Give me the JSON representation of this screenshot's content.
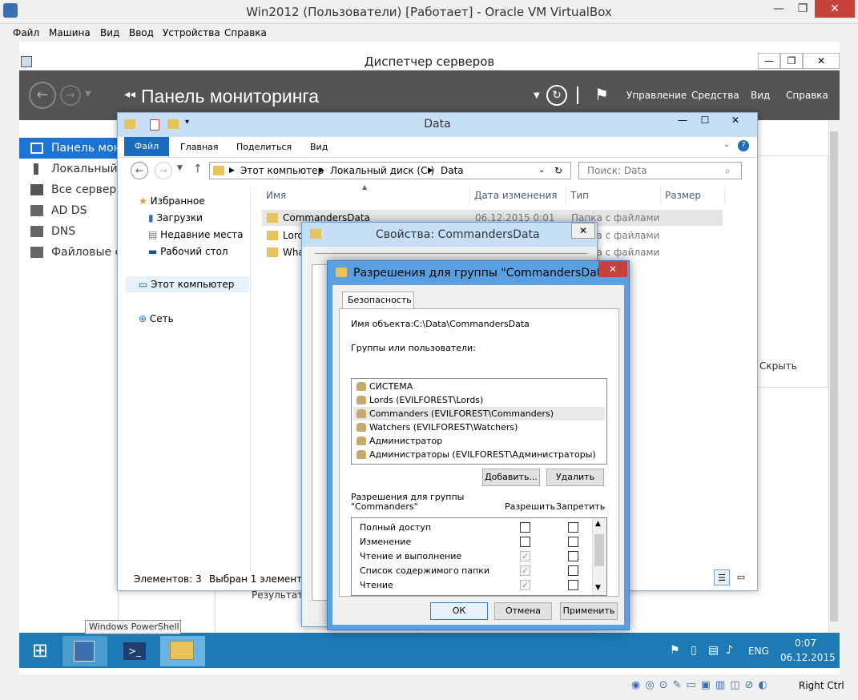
{
  "vbox": {
    "title": "Win2012 (Пользователи) [Работает] - Oracle VM VirtualBox",
    "menu": [
      "Файл",
      "Машина",
      "Вид",
      "Ввод",
      "Устройства",
      "Справка"
    ],
    "host_key": "Right Ctrl"
  },
  "server_manager": {
    "window_title": "Диспетчер серверов",
    "header_title": "Панель мониторинга",
    "header_menu": [
      "Управление",
      "Средства",
      "Вид",
      "Справка"
    ],
    "sidebar": [
      {
        "label": "Панель мони",
        "icon": "dashboard-icon",
        "active": true
      },
      {
        "label": "Локальный с",
        "icon": "server-icon",
        "active": false
      },
      {
        "label": "Все серверы",
        "icon": "servers-icon",
        "active": false
      },
      {
        "label": "AD DS",
        "icon": "ad-icon",
        "active": false
      },
      {
        "label": "DNS",
        "icon": "dns-icon",
        "active": false
      },
      {
        "label": "Файловые сл",
        "icon": "file-services-icon",
        "active": false
      }
    ],
    "hide_label": "Скрыть",
    "results_label": "Результат"
  },
  "taskbar": {
    "tooltip": "Windows PowerShell",
    "language": "ENG",
    "time": "0:07",
    "date": "06.12.2015"
  },
  "explorer": {
    "title": "Data",
    "ribbon_tabs": [
      "Файл",
      "Главная",
      "Поделиться",
      "Вид"
    ],
    "address": [
      "Этот компьютер",
      "Локальный диск (C:)",
      "Data"
    ],
    "search_placeholder": "Поиск: Data",
    "nav": {
      "favorites": "Избранное",
      "downloads": "Загрузки",
      "recent": "Недавние места",
      "desktop": "Рабочий стол",
      "this_pc": "Этот компьютер",
      "network": "Сеть"
    },
    "columns": [
      "Имя",
      "Дата изменения",
      "Тип",
      "Размер"
    ],
    "rows": [
      {
        "name": "CommandersData",
        "date": "06.12.2015 0:01",
        "type": "Папка с файлами"
      },
      {
        "name": "Lords",
        "date": "",
        "type": "Папка с файлами"
      },
      {
        "name": "Wha",
        "date": "",
        "type": "Папка с файлами"
      }
    ],
    "status_count": "Элементов: 3",
    "status_selected": "Выбран 1 элемент"
  },
  "properties": {
    "title": "Свойства: CommandersData"
  },
  "permissions": {
    "title": "Разрешения для группы \"CommandersData\"",
    "tab": "Безопасность",
    "object_label": "Имя объекта:",
    "object_value": "C:\\Data\\CommandersData",
    "groups_label": "Группы или пользователи:",
    "users": [
      "СИСТЕМА",
      "Lords (EVILFOREST\\Lords)",
      "Commanders (EVILFOREST\\Commanders)",
      "Watchers (EVILFOREST\\Watchers)",
      "Администратор",
      "Администраторы (EVILFOREST\\Администраторы)"
    ],
    "add_button": "Добавить...",
    "remove_button": "Удалить",
    "perm_for_label_1": "Разрешения для группы",
    "perm_for_label_2": "\"Commanders\"",
    "allow_label": "Разрешить",
    "deny_label": "Запретить",
    "perms": [
      {
        "name": "Полный доступ",
        "allow": false,
        "allow_disabled": false
      },
      {
        "name": "Изменение",
        "allow": false,
        "allow_disabled": false
      },
      {
        "name": "Чтение и выполнение",
        "allow": true,
        "allow_disabled": true
      },
      {
        "name": "Список содержимого папки",
        "allow": true,
        "allow_disabled": true
      },
      {
        "name": "Чтение",
        "allow": true,
        "allow_disabled": true
      }
    ],
    "ok": "ОК",
    "cancel": "Отмена",
    "apply": "Применить"
  }
}
